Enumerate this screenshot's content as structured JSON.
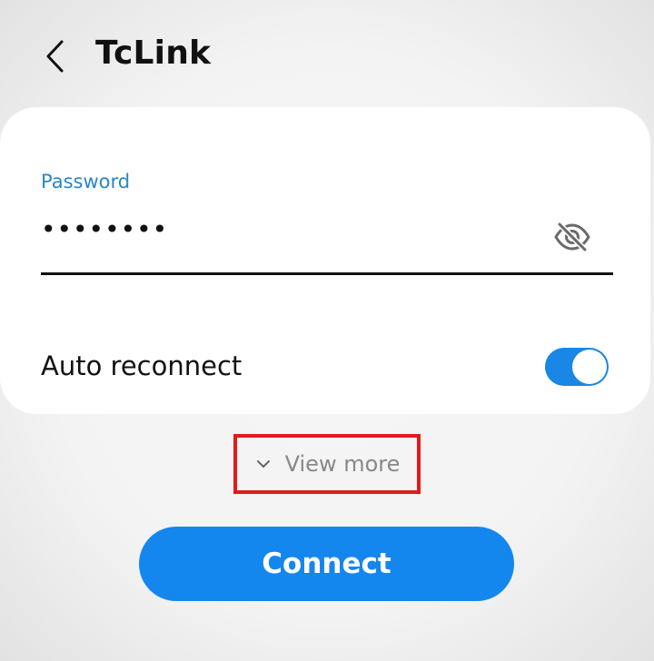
{
  "header": {
    "title": "TcLink",
    "back_icon": "chevron-left-icon"
  },
  "password": {
    "label": "Password",
    "masked_value": "••••••••",
    "visibility_icon": "eye-off-icon"
  },
  "auto_reconnect": {
    "label": "Auto reconnect",
    "enabled": true
  },
  "view_more": {
    "label": "View more",
    "icon": "chevron-down-icon"
  },
  "connect": {
    "label": "Connect"
  },
  "colors": {
    "accent": "#1487ef",
    "label_blue": "#2a86c6",
    "highlight": "#e11b1b"
  }
}
